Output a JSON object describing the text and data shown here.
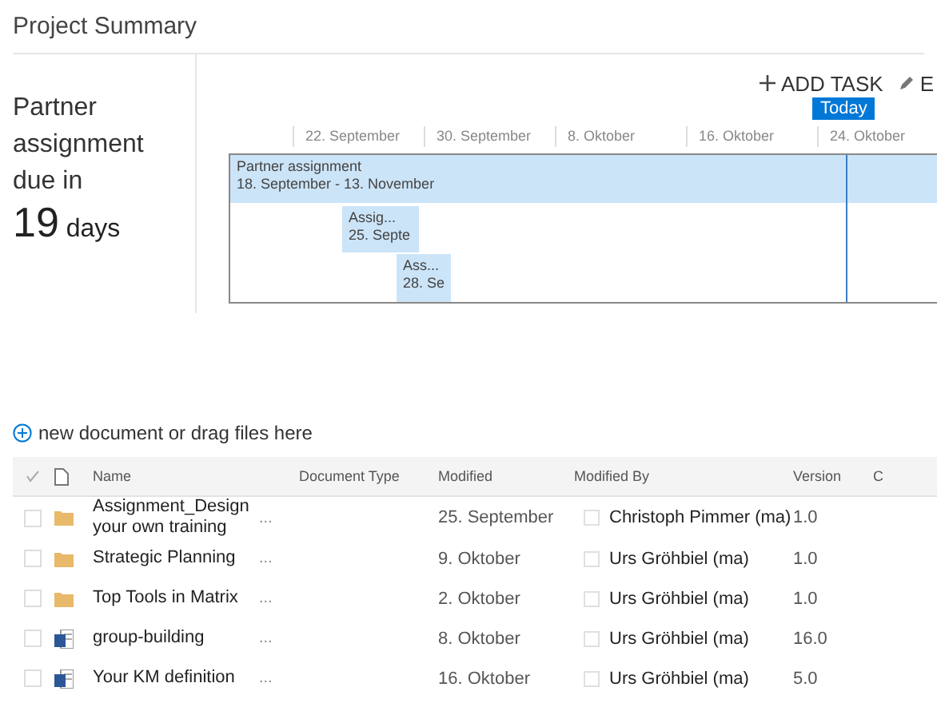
{
  "title": "Project Summary",
  "summary": {
    "text": "Partner assignment due in",
    "count": "19",
    "unit": "days"
  },
  "timeline": {
    "actions": [
      {
        "kind": "add",
        "label": "ADD TASK"
      },
      {
        "kind": "edit",
        "label": "E"
      }
    ],
    "today": "Today",
    "dates": [
      "22. September",
      "30. September",
      "8. Oktober",
      "16. Oktober",
      "24. Oktober"
    ],
    "tasks": [
      {
        "name": "Partner assignment",
        "dates": "18. September - 13. November"
      },
      {
        "name": "Assig...",
        "dates": "25. Septe"
      },
      {
        "name": "Ass...",
        "dates": "28. Se"
      }
    ]
  },
  "new_document": "new document or drag files here",
  "table": {
    "columns": [
      "Name",
      "Document Type",
      "Modified",
      "Modified By",
      "Version",
      "C"
    ],
    "rows": [
      {
        "kind": "folder",
        "checked": false,
        "name": "Assignment_Design your own training",
        "menu": "...",
        "modified": "25. September",
        "modified_by": "Christoph Pimmer (ma)",
        "version": "1.0"
      },
      {
        "kind": "folder",
        "checked": false,
        "name": "Strategic Planning",
        "menu": "...",
        "modified": "9. Oktober",
        "modified_by": "Urs Gröhbiel (ma)",
        "version": "1.0"
      },
      {
        "kind": "folder",
        "checked": false,
        "name": "Top Tools in Matrix",
        "menu": "...",
        "modified": "2. Oktober",
        "modified_by": "Urs Gröhbiel (ma)",
        "version": "1.0"
      },
      {
        "kind": "word",
        "checked": false,
        "name": "group-building",
        "menu": "...",
        "modified": "8. Oktober",
        "modified_by": "Urs Gröhbiel (ma)",
        "version": "16.0"
      },
      {
        "kind": "word",
        "checked": false,
        "name": "Your KM definition",
        "menu": "...",
        "modified": "16. Oktober",
        "modified_by": "Urs Gröhbiel (ma)",
        "version": "5.0"
      }
    ]
  }
}
